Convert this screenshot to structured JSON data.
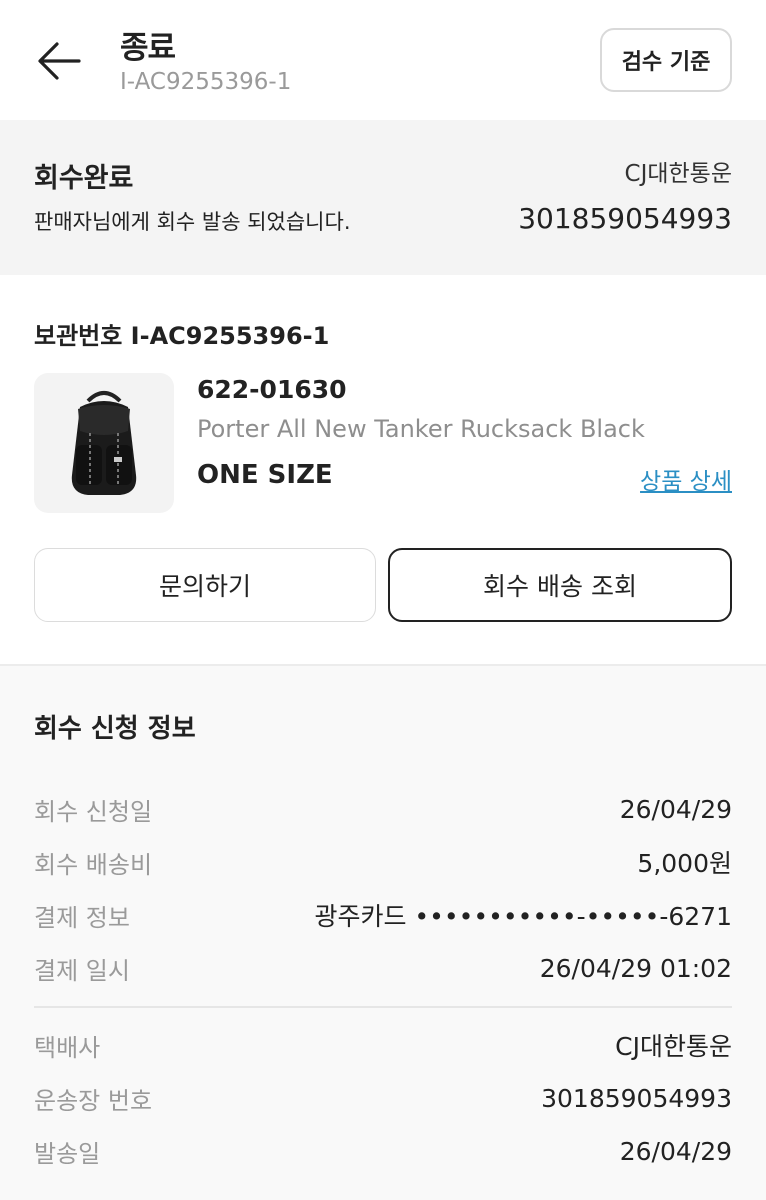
{
  "header": {
    "title": "종료",
    "subtitle": "I-AC9255396-1",
    "inspect_label": "검수 기준"
  },
  "status": {
    "title": "회수완료",
    "description": "판매자님에게 회수 발송 되었습니다.",
    "carrier": "CJ대한통운",
    "tracking": "301859054993"
  },
  "product": {
    "storage_label": "보관번호 I-AC9255396-1",
    "model": "622-01630",
    "name": "Porter All New Tanker Rucksack Black",
    "size": "ONE SIZE",
    "detail_link": "상품 상세",
    "image": "black-backpack"
  },
  "actions": {
    "inquiry": "문의하기",
    "track": "회수 배송 조회"
  },
  "info": {
    "title": "회수 신청 정보",
    "rows": [
      {
        "label": "회수 신청일",
        "value": "26/04/29"
      },
      {
        "label": "회수 배송비",
        "value": "5,000원"
      },
      {
        "label": "결제 정보",
        "value": "광주카드 •••••••••••-•••••-6271"
      },
      {
        "label": "결제 일시",
        "value": "26/04/29 01:02"
      }
    ],
    "shipping_rows": [
      {
        "label": "택배사",
        "value": "CJ대한통운"
      },
      {
        "label": "운송장 번호",
        "value": "301859054993"
      },
      {
        "label": "발송일",
        "value": "26/04/29"
      }
    ]
  },
  "colors": {
    "link": "#2b8fc4",
    "muted": "#9a9a9a",
    "status_bg": "#f4f4f4"
  }
}
